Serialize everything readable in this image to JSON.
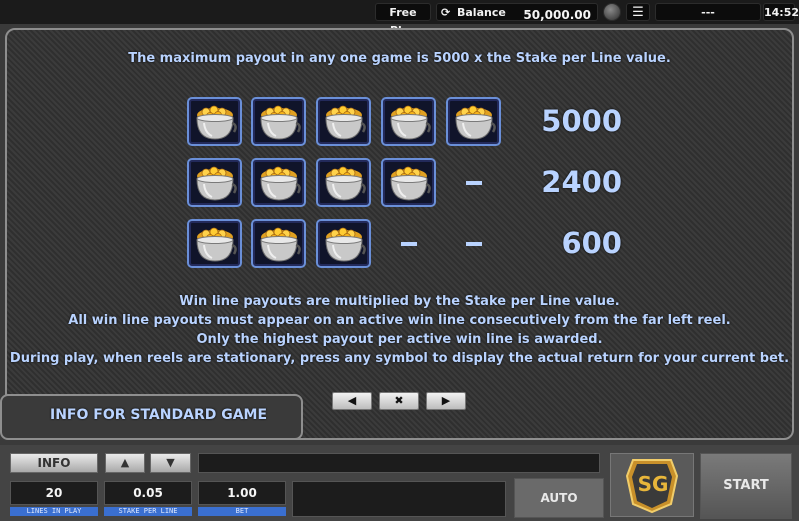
{
  "top_bar": {
    "free_play": "Free Play",
    "balance_label": "Balance",
    "balance_value": "50,000.00",
    "status_text": "---",
    "clock": "14:52"
  },
  "paytable": {
    "max_payout_text": "The maximum payout in any one game is 5000 x the Stake per Line value.",
    "symbol_name": "pot of gold",
    "rows": [
      {
        "count": 5,
        "payout": "5000"
      },
      {
        "count": 4,
        "payout": "2400"
      },
      {
        "count": 3,
        "payout": "600"
      }
    ],
    "info_lines": [
      "Win line payouts are multiplied by the Stake per Line value.",
      "All win line payouts must appear on an active win line consecutively from the far left reel.",
      "Only the highest payout per active win line is awarded.",
      "During play, when reels are stationary, press any symbol to display the actual return for your current bet."
    ]
  },
  "info_tab": {
    "title": "INFO FOR STANDARD GAME"
  },
  "nav": {
    "prev_icon": "left-arrow-icon",
    "close_icon": "close-icon",
    "next_icon": "right-arrow-icon"
  },
  "controls": {
    "info_label": "INFO",
    "lines_value": "20",
    "lines_caption": "LINES IN PLAY",
    "stake_value": "0.05",
    "stake_caption": "STAKE PER LINE",
    "bet_value": "1.00",
    "bet_caption": "BET",
    "auto_label": "AUTO",
    "logo_text": "SG",
    "start_label": "START"
  },
  "colors": {
    "accent_blue": "#b9d3ff",
    "caption_blue": "#3a6fd0",
    "logo_gold": "#d9a62b"
  }
}
